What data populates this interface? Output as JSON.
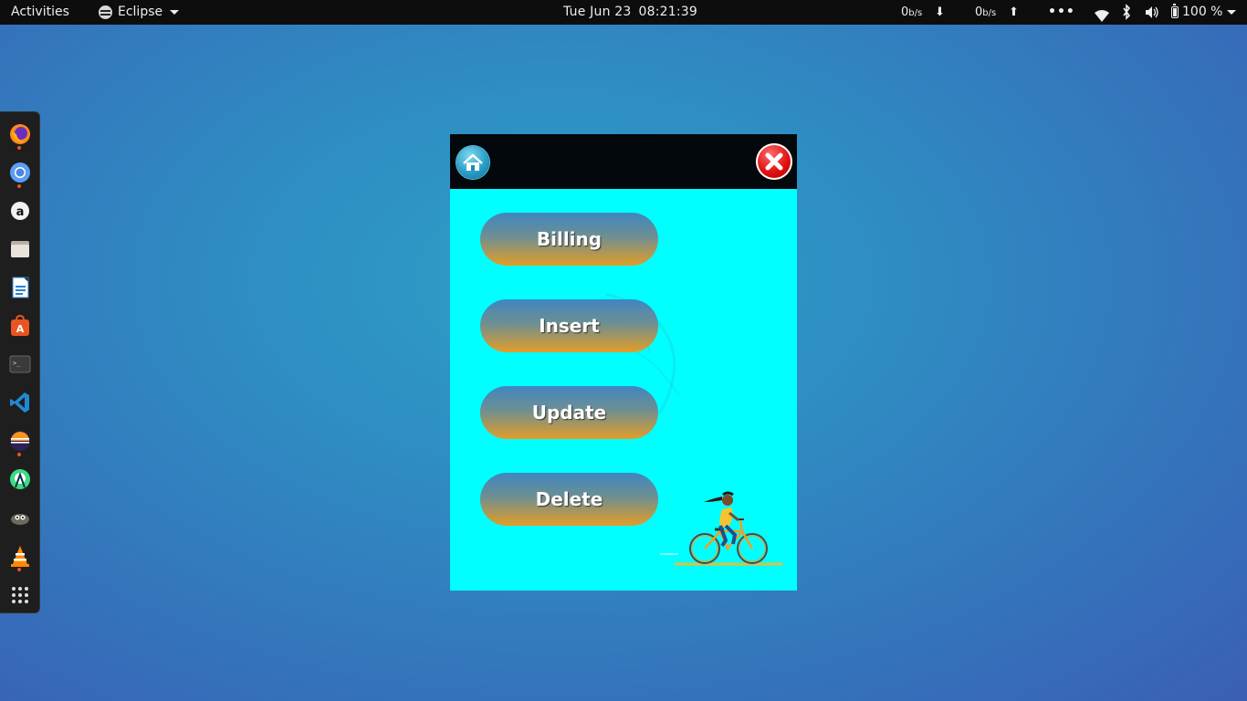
{
  "topbar": {
    "activities": "Activities",
    "app_name": "Eclipse",
    "date": "Tue Jun 23",
    "time": "08:21:39",
    "net_down_value": "0",
    "net_down_unit": "b/s",
    "net_up_value": "0",
    "net_up_unit": "b/s",
    "battery": "100 %"
  },
  "dock": {
    "items": [
      "firefox-icon",
      "chromium-icon",
      "amazon-icon",
      "files-icon",
      "writer-icon",
      "software-center-icon",
      "terminal-icon",
      "vscode-icon",
      "eclipse-icon",
      "android-studio-icon",
      "gimp-icon",
      "vlc-icon",
      "show-apps-icon"
    ]
  },
  "app": {
    "buttons": {
      "billing": "Billing",
      "insert": "Insert",
      "update": "Update",
      "delete": "Delete"
    },
    "colors": {
      "background": "#00ffff",
      "header": "#03080c",
      "button_top": "#3f86c0",
      "button_bottom": "#e39d27",
      "close": "#e00f0f"
    }
  }
}
